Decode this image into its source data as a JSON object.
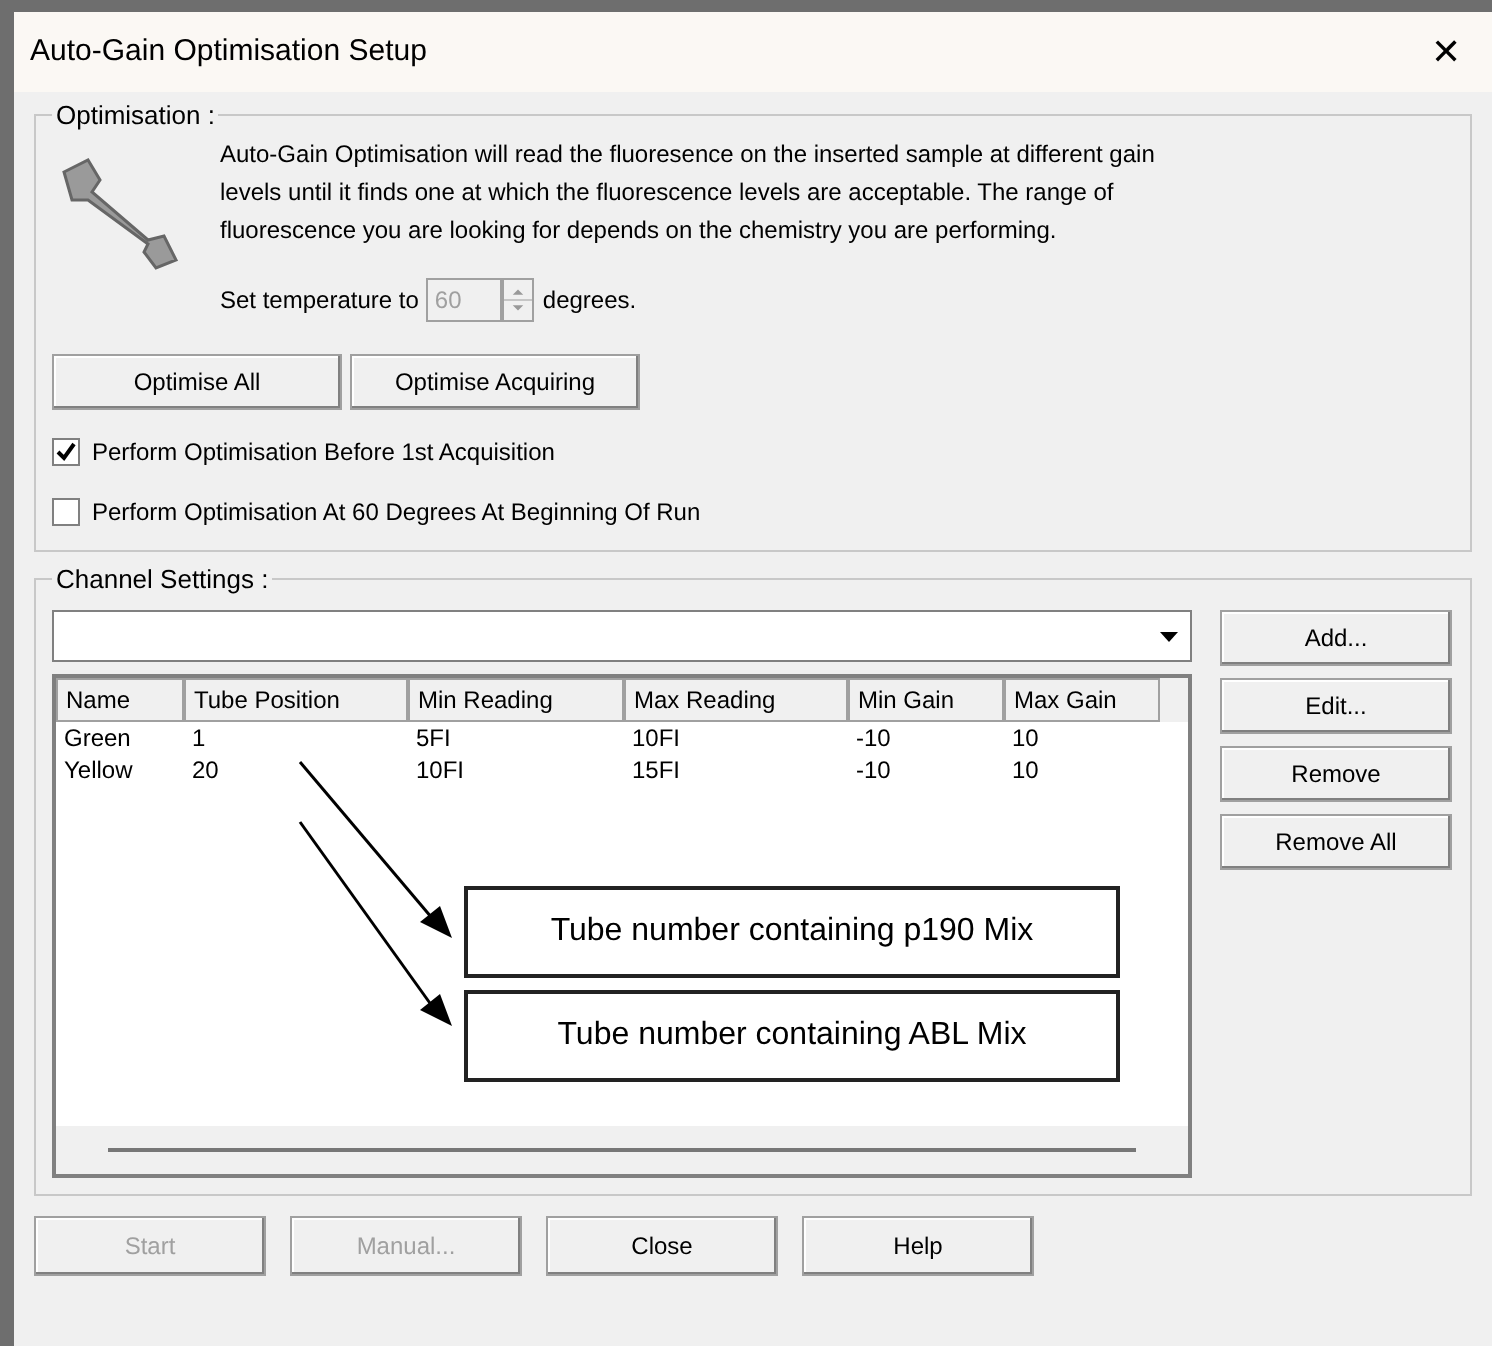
{
  "window": {
    "title": "Auto-Gain Optimisation Setup",
    "close": "✕"
  },
  "optimisation": {
    "legend": "Optimisation :",
    "description": "Auto-Gain Optimisation will read the fluoresence on the inserted sample at different gain levels until it finds one at which the fluorescence levels are acceptable. The range of fluorescence you are looking for depends on the chemistry you are performing.",
    "temperature_label": "Set temperature to",
    "temperature_value": "60",
    "temperature_disabled": true,
    "temperature_unit": "degrees.",
    "buttons": [
      "Optimise All",
      "Optimise Acquiring"
    ],
    "options": [
      {
        "label": "Perform Optimisation Before 1st Acquisition",
        "checked": true
      },
      {
        "label": "Perform Optimisation At 60 Degrees At Beginning Of Run",
        "checked": false
      }
    ]
  },
  "channel_settings": {
    "legend": "Channel Settings :",
    "columns": [
      "Name",
      "Tube Position",
      "Min Reading",
      "Max Reading",
      "Min Gain",
      "Max Gain"
    ],
    "rows": [
      [
        "Green",
        "1",
        "5FI",
        "10FI",
        "-10",
        "10"
      ],
      [
        "Yellow",
        "20",
        "10FI",
        "15FI",
        "-10",
        "10"
      ]
    ],
    "callouts": [
      "Tube number containing p190 Mix",
      "Tube number containing ABL Mix"
    ],
    "side_buttons": [
      "Add...",
      "Edit...",
      "Remove",
      "Remove All"
    ]
  },
  "footer_buttons": [
    {
      "label": "Start",
      "disabled": true
    },
    {
      "label": "Manual...",
      "disabled": true
    },
    {
      "label": "Close",
      "disabled": false
    },
    {
      "label": "Help",
      "disabled": false
    }
  ]
}
